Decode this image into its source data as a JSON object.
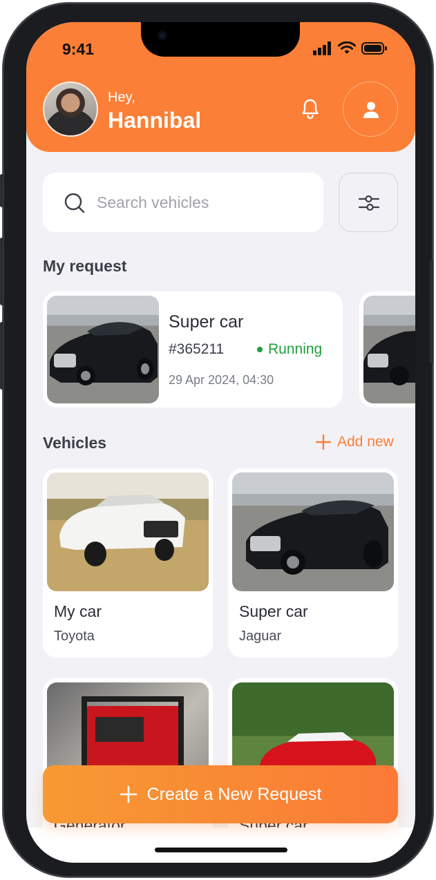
{
  "status_bar": {
    "time": "9:41"
  },
  "header": {
    "greeting": "Hey,",
    "user_name": "Hannibal"
  },
  "search": {
    "placeholder": "Search vehicles"
  },
  "my_request": {
    "title": "My request",
    "cards": [
      {
        "name": "Super car",
        "id": "#365211",
        "status": "Running",
        "date": "29 Apr 2024, 04:30"
      }
    ]
  },
  "vehicles": {
    "title": "Vehicles",
    "add_new_label": "Add new",
    "items": [
      {
        "name": "My car",
        "brand": "Toyota"
      },
      {
        "name": "Super car",
        "brand": "Jaguar"
      },
      {
        "name": "Generator",
        "brand": ""
      },
      {
        "name": "Super car",
        "brand": ""
      }
    ]
  },
  "cta": {
    "label": "Create a New Request"
  },
  "colors": {
    "accent": "#fb7f36",
    "running": "#1f9e3a",
    "background": "#f2f2f6"
  },
  "icons": [
    "bell-icon",
    "user-icon",
    "search-icon",
    "filter-icon",
    "plus-icon"
  ]
}
